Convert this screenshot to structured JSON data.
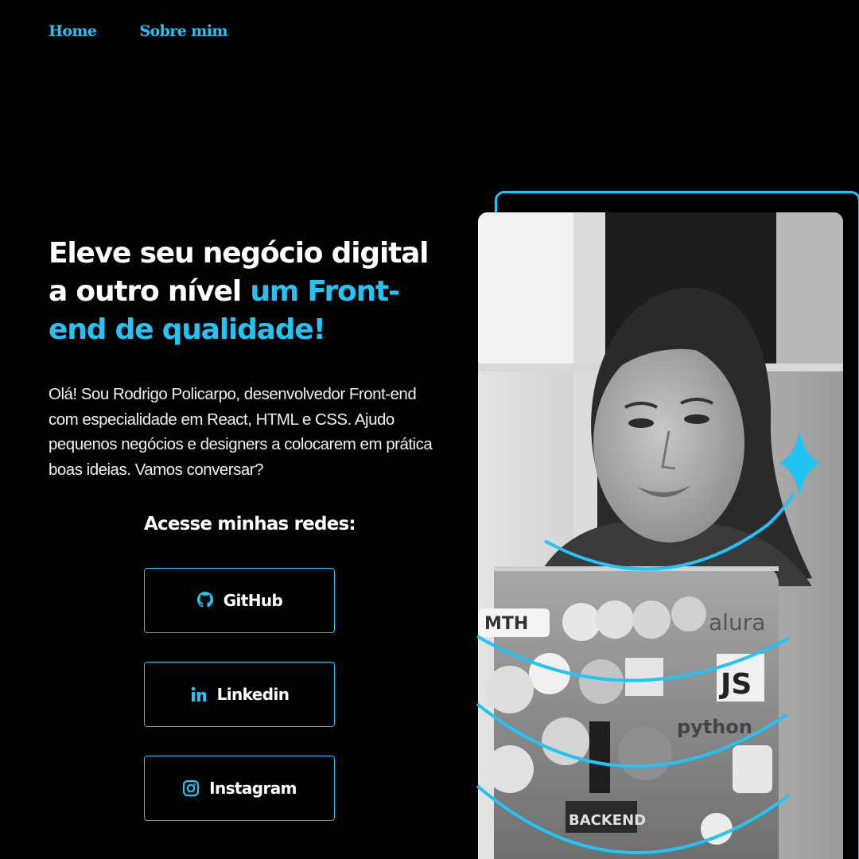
{
  "colors": {
    "background": "#000000",
    "text": "#ffffff",
    "accent": "#22c3f5",
    "border": "#22c3f5"
  },
  "nav": {
    "items": [
      {
        "label": "Home"
      },
      {
        "label": "Sobre mim"
      }
    ]
  },
  "hero": {
    "headline_part1": "Eleve seu negócio digital a outro nível ",
    "headline_highlight": "um Front-end de qualidade!",
    "intro": "Olá! Sou Rodrigo Policarpo, desenvolvedor Front-end com especialidade em React, HTML e CSS. Ajudo pequenos negócios e designers a colocarem em prática boas ideias. Vamos conversar?"
  },
  "social": {
    "title": "Acesse minhas redes:",
    "buttons": [
      {
        "label": "GitHub",
        "icon": "github-icon"
      },
      {
        "label": "Linkedin",
        "icon": "linkedin-icon"
      },
      {
        "label": "Instagram",
        "icon": "instagram-icon"
      }
    ]
  },
  "photo": {
    "description_icon": "profile-photo",
    "sticker_texts": [
      "MTH",
      "alura",
      "JS",
      "python",
      "BACKEND"
    ]
  }
}
